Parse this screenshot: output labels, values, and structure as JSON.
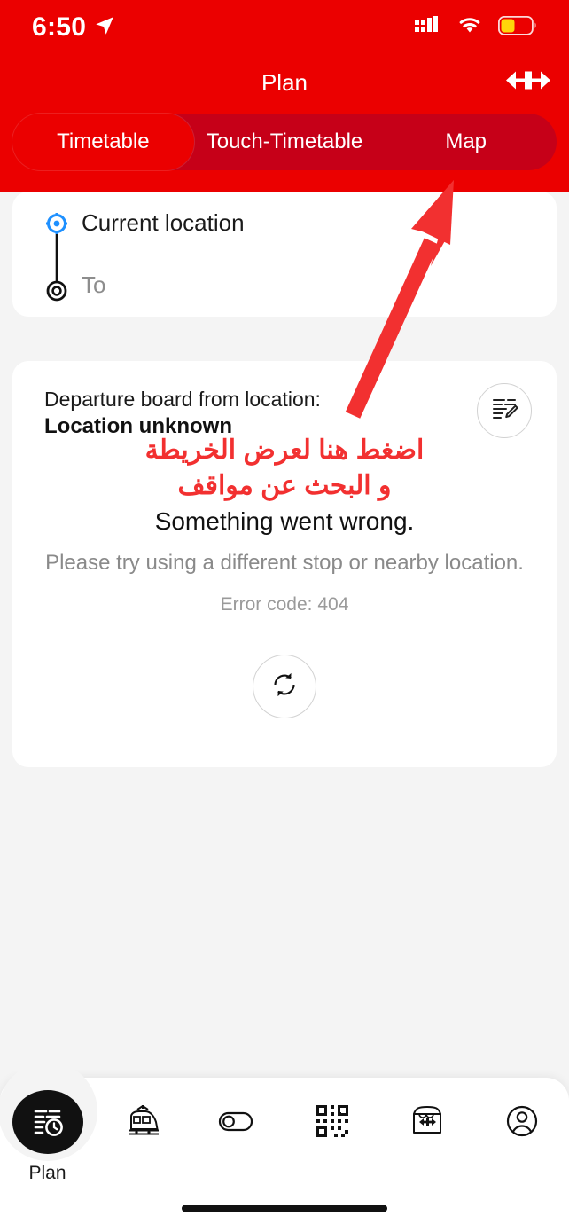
{
  "status_bar": {
    "time": "6:50",
    "location_icon": "location-arrow-icon",
    "cellular_icon": "cellular-signal-icon",
    "wifi_icon": "wifi-icon",
    "battery_icon": "battery-low-power-icon",
    "battery_color": "#FFD60A"
  },
  "header": {
    "title": "Plan",
    "brand_logo": "sbb-logo",
    "background_color": "#EB0000"
  },
  "segmented_control": {
    "track_color": "#C60018",
    "active_color": "#EB0000",
    "selected": "Timetable",
    "tabs": [
      {
        "label": "Timetable",
        "active": true
      },
      {
        "label": "Touch-Timetable",
        "active": false
      },
      {
        "label": "Map",
        "active": false
      }
    ]
  },
  "route_card": {
    "from": {
      "value": "Current location",
      "icon": "current-location-crosshair-icon",
      "icon_color": "#1E90FF"
    },
    "to": {
      "placeholder": "To",
      "value": "",
      "icon": "destination-target-icon",
      "icon_color": "#111111"
    }
  },
  "departure_card": {
    "label": "Departure board from location:",
    "location": "Location unknown",
    "edit_icon": "edit-timetable-icon",
    "error_title": "Something went wrong.",
    "error_subtitle": "Please try using a different stop or nearby location.",
    "error_code": "Error code: 404",
    "refresh_icon": "refresh-icon"
  },
  "annotation": {
    "color": "#F23030",
    "arrow_icon": "pointing-arrow-icon",
    "lines": [
      "اضغط هنا لعرض الخريطة",
      "و البحث عن مواقف"
    ]
  },
  "tab_bar": {
    "items": [
      {
        "name": "plan",
        "label": "Plan",
        "icon": "timetable-clock-icon",
        "active": true
      },
      {
        "name": "trips",
        "label": "",
        "icon": "tram-icon",
        "active": false
      },
      {
        "name": "toggle",
        "label": "",
        "icon": "toggle-switch-icon",
        "active": false
      },
      {
        "name": "ticket",
        "label": "",
        "icon": "qr-code-icon",
        "active": false
      },
      {
        "name": "store",
        "label": "",
        "icon": "store-icon",
        "active": false
      },
      {
        "name": "account",
        "label": "",
        "icon": "account-person-icon",
        "active": false
      }
    ]
  }
}
